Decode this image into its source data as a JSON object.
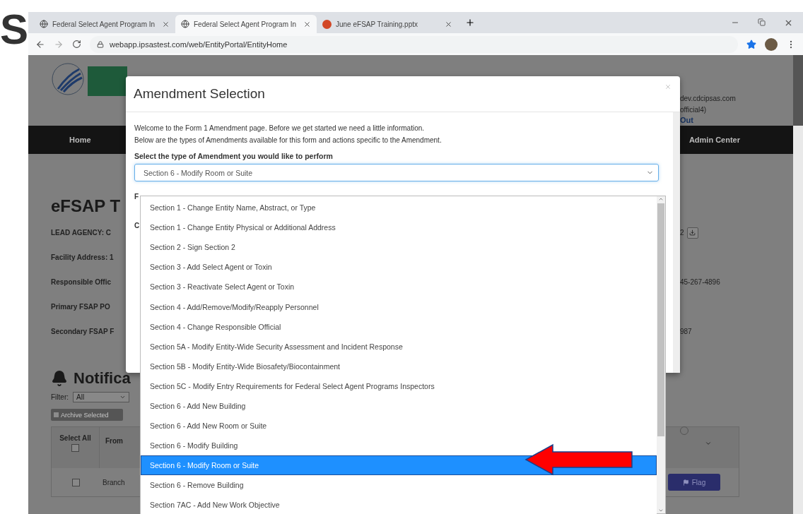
{
  "slide_title_fragment": "S",
  "browser": {
    "tabs": [
      {
        "title": "Federal Select Agent Program In",
        "selected": false,
        "kind": "web"
      },
      {
        "title": "Federal Select Agent Program In",
        "selected": true,
        "kind": "web"
      },
      {
        "title": "June eFSAP Training.pptx",
        "selected": false,
        "kind": "slides"
      }
    ],
    "url": "webapp.ipsastest.com/web/EntityPortal/EntityHome"
  },
  "page": {
    "user_lines": [
      "dev.cdcipsas.com",
      "official4)"
    ],
    "sign_out": "Out",
    "nav": [
      "Home",
      "Admin Center"
    ],
    "heading": "eFSAP T",
    "details": [
      {
        "label": "LEAD AGENCY: C",
        "value": "2",
        "kind": "file"
      },
      {
        "label": "Facility Address: 1",
        "kind": "text"
      },
      {
        "label": "Responsible Offic",
        "value": "45-267-4896",
        "kind": "text"
      },
      {
        "label": "Primary FSAP PO",
        "kind": "text"
      },
      {
        "label": "Secondary FSAP F",
        "value": "987",
        "kind": "text"
      }
    ],
    "notifications": {
      "heading": "Notifica",
      "filter_label": "Filter:",
      "filter_value": "All",
      "archive_button": "Archive Selected",
      "columns": [
        "Select All",
        "From"
      ],
      "select_all_checked": false,
      "radio_selected": false,
      "rows": [
        {
          "from": "Branch",
          "checked": false,
          "flag": "Flag"
        }
      ]
    }
  },
  "modal": {
    "title": "Amendment Selection",
    "intro": [
      "Welcome to the Form 1 Amendment page. Before we get started we need a little information.",
      "Below are the types of Amendments available for this form and actions specific to the Amendment."
    ],
    "prompt": "Select the type of Amendment you would like to perform",
    "select_value": "Section 6 - Modify Room or Suite",
    "hidden_labels": [
      "F",
      "C"
    ],
    "options": [
      {
        "label": "Section 1 - Change Entity Name, Abstract, or Type",
        "selected": false
      },
      {
        "label": "Section 1 - Change Entity Physical or Additional Address",
        "selected": false
      },
      {
        "label": "Section 2 - Sign Section 2",
        "selected": false
      },
      {
        "label": "Section 3 - Add Select Agent or Toxin",
        "selected": false
      },
      {
        "label": "Section 3 - Reactivate Select Agent or Toxin",
        "selected": false
      },
      {
        "label": "Section 4 - Add/Remove/Modify/Reapply Personnel",
        "selected": false
      },
      {
        "label": "Section 4 - Change Responsible Official",
        "selected": false
      },
      {
        "label": "Section 5A - Modify Entity-Wide Security Assessment and Incident Response",
        "selected": false
      },
      {
        "label": "Section 5B - Modify Entity-Wide Biosafety/Biocontainment",
        "selected": false
      },
      {
        "label": "Section 5C - Modify Entry Requirements for Federal Select Agent Programs Inspectors",
        "selected": false
      },
      {
        "label": "Section 6 - Add New Building",
        "selected": false
      },
      {
        "label": "Section 6 - Add New Room or Suite",
        "selected": false
      },
      {
        "label": "Section 6 - Modify Building",
        "selected": false
      },
      {
        "label": "Section 6 - Modify Room or Suite",
        "selected": true
      },
      {
        "label": "Section 6 - Remove Building",
        "selected": false
      },
      {
        "label": "Section 7AC - Add New Work Objective",
        "selected": false
      }
    ]
  }
}
